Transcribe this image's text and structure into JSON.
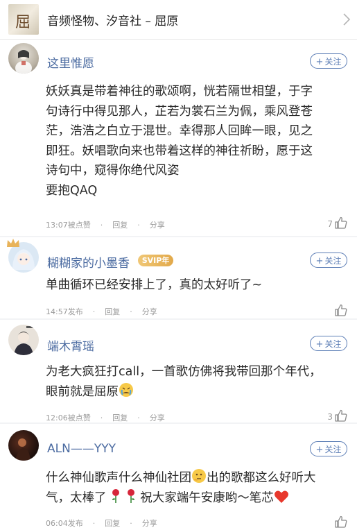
{
  "header": {
    "cover_text": "屈原",
    "title": "音频怪物、汐音社 – 屈原"
  },
  "follow_label": "关注",
  "comments": [
    {
      "user": "这里惟愿",
      "lines": [
        "妖妖真是带着神往的歌颂啊，恍若隔世相望，于字",
        "句诗行中得见那人，芷若为裳石兰为佩，乘风登苍",
        "茫，浩浩之白立于混世。幸得那人回眸一眼，见之",
        "即狂。妖唱歌向来也带着这样的神往祈盼，愿于这",
        "诗句中，窥得你绝代风姿",
        "要抱QAQ"
      ],
      "time": "13:07被点赞",
      "reply": "回复",
      "share": "分享",
      "likes": "7"
    },
    {
      "user": "糊糊家的小墨香",
      "badge": "SVIP年",
      "lines": [
        "单曲循环已经安排上了，真的太好听了~"
      ],
      "time": "14:57发布",
      "reply": "回复",
      "share": "分享",
      "likes": ""
    },
    {
      "user": "端木霄瑶",
      "line1": "为老大疯狂打call，一首歌仿佛将我带回那个年代，",
      "line2": "眼前就是屈原",
      "time": "12:06被点赞",
      "reply": "回复",
      "share": "分享",
      "likes": "3"
    },
    {
      "user": "ALN——YYY",
      "line1a": "什么神仙歌声什么神仙社团",
      "line1b": "出的歌都这么好听大",
      "line2a": "气，太棒了",
      "line2b": "祝大家端午安康哟～笔芯",
      "time": "06:04发布",
      "reply": "回复",
      "share": "分享",
      "likes": ""
    }
  ],
  "colors": {
    "username": "#4a6aa0",
    "follow": "#5b7db5",
    "svip": "#e8b35a"
  }
}
